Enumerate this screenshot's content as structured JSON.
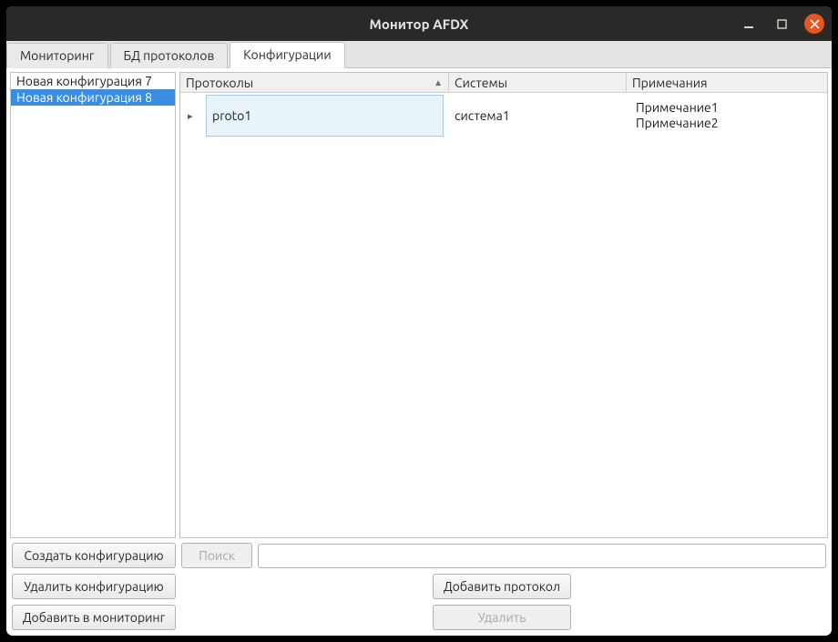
{
  "window": {
    "title": "Монитор AFDX"
  },
  "tabs": [
    {
      "label": "Мониторинг",
      "active": false
    },
    {
      "label": "БД протоколов",
      "active": false
    },
    {
      "label": "Конфигурации",
      "active": true
    }
  ],
  "sidebar": {
    "items": [
      {
        "label": "Новая конфигурация 7",
        "selected": false
      },
      {
        "label": "Новая конфигурация 8",
        "selected": true
      }
    ]
  },
  "table": {
    "columns": {
      "protocols": "Протоколы",
      "systems": "Системы",
      "notes": "Примечания"
    },
    "rows": [
      {
        "protocol": "proto1",
        "system": "система1",
        "notes": [
          "Примечание1",
          "Примечание2"
        ]
      }
    ]
  },
  "buttons": {
    "create_config": "Создать конфигурацию",
    "delete_config": "Удалить конфигурацию",
    "add_monitor": "Добавить в мониторинг",
    "search": "Поиск",
    "add_protocol": "Добавить протокол",
    "delete": "Удалить"
  },
  "search": {
    "value": "",
    "placeholder": ""
  }
}
